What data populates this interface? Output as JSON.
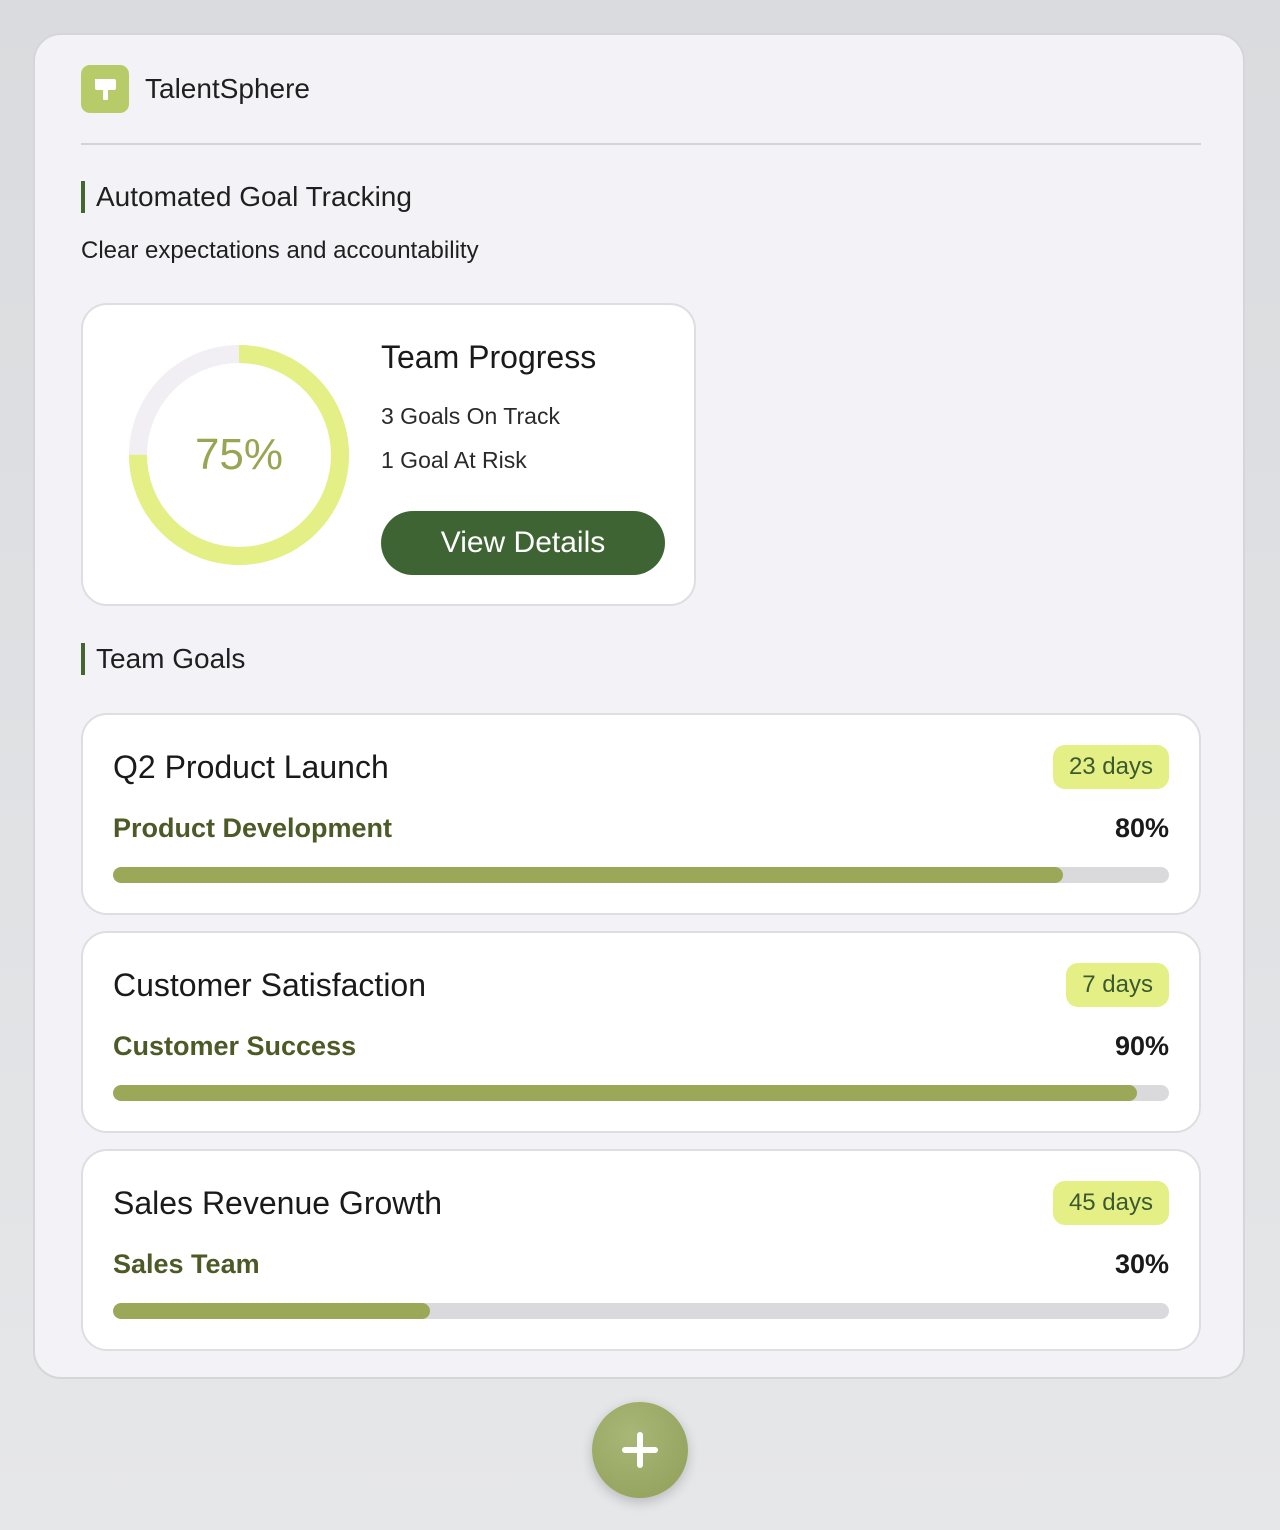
{
  "app": {
    "name": "TalentSphere"
  },
  "section": {
    "title": "Automated Goal Tracking",
    "subtitle": "Clear expectations and accountability"
  },
  "progress_card": {
    "percent_label": "75%",
    "percent_value": 75,
    "title": "Team Progress",
    "on_track": "3 Goals On Track",
    "at_risk": "1 Goal At Risk",
    "button_label": "View Details"
  },
  "goals_section": {
    "title": "Team Goals"
  },
  "goals": [
    {
      "title": "Q2 Product Launch",
      "days": "23 days",
      "team": "Product Development",
      "percent_label": "80%",
      "bar_fraction": 0.9
    },
    {
      "title": "Customer Satisfaction",
      "days": "7 days",
      "team": "Customer Success",
      "percent_label": "90%",
      "bar_fraction": 0.97
    },
    {
      "title": "Sales Revenue Growth",
      "days": "45 days",
      "team": "Sales Team",
      "percent_label": "30%",
      "bar_fraction": 0.3
    }
  ],
  "fab": {
    "icon": "plus-icon"
  },
  "colors": {
    "accent_dark": "#3f6433",
    "accent_light": "#e4ef86",
    "bar_fill": "#9aa858",
    "logo": "#b7cc68"
  }
}
